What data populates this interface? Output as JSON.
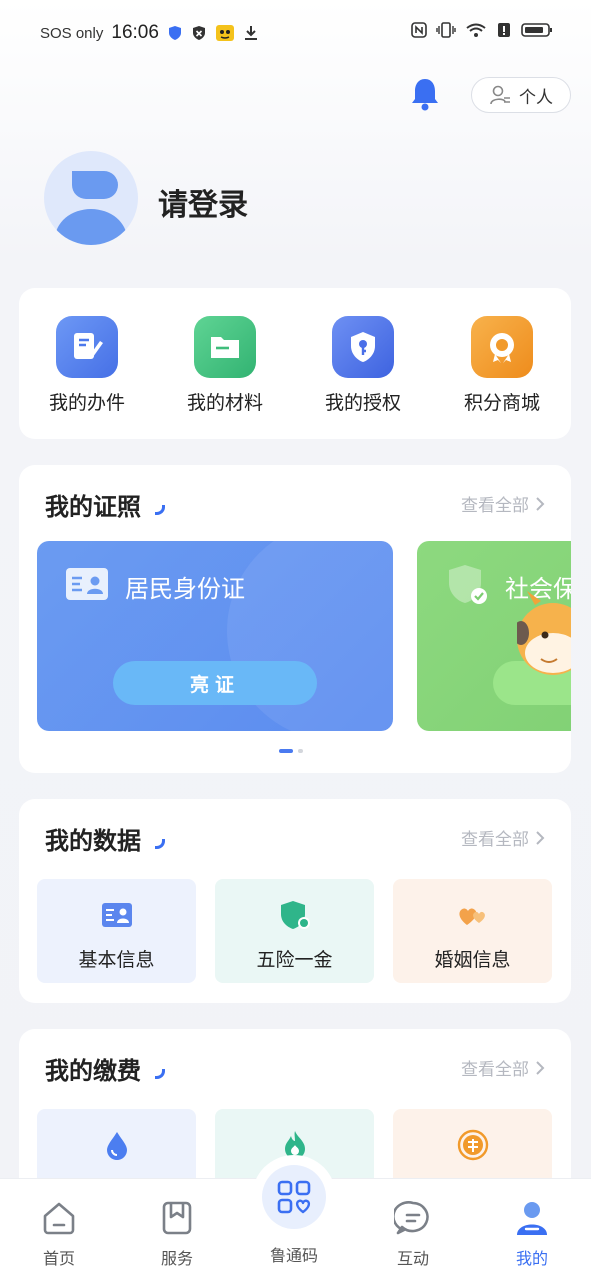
{
  "status_bar": {
    "carrier": "SOS only",
    "time": "16:06"
  },
  "header": {
    "personal_label": "个人"
  },
  "profile": {
    "login_text": "请登录"
  },
  "quick_entries": [
    {
      "label": "我的办件",
      "icon": "edit-doc-icon",
      "color": "#4c79ec"
    },
    {
      "label": "我的材料",
      "icon": "folder-icon",
      "color": "#3fbd7b"
    },
    {
      "label": "我的授权",
      "icon": "shield-key-icon",
      "color": "#4a6fe8"
    },
    {
      "label": "积分商城",
      "icon": "badge-award-icon",
      "color": "#f19a2b"
    }
  ],
  "licenses": {
    "title": "我的证照",
    "see_all": "查看全部",
    "cards": [
      {
        "name": "居民身份证",
        "button": "亮证",
        "icon": "id-card-icon"
      },
      {
        "name": "社会保",
        "icon": "social-security-icon"
      }
    ]
  },
  "my_data": {
    "title": "我的数据",
    "see_all": "查看全部",
    "items": [
      {
        "label": "基本信息",
        "icon": "id-card-icon",
        "bg": "#edf2fd"
      },
      {
        "label": "五险一金",
        "icon": "insurance-shield-icon",
        "bg": "#eaf7f5"
      },
      {
        "label": "婚姻信息",
        "icon": "hearts-icon",
        "bg": "#fdf2ea"
      }
    ]
  },
  "my_fees": {
    "title": "我的缴费",
    "see_all": "查看全部",
    "items": [
      {
        "icon": "water-drop-icon",
        "bg": "#edf2fd"
      },
      {
        "icon": "flame-icon",
        "bg": "#eaf7f5"
      },
      {
        "icon": "tax-coin-icon",
        "bg": "#fdf2ea"
      }
    ]
  },
  "bottom_nav": [
    {
      "label": "首页",
      "icon": "home-icon"
    },
    {
      "label": "服务",
      "icon": "bookmark-icon"
    },
    {
      "label": "鲁通码",
      "icon": "qr-grid-icon"
    },
    {
      "label": "互动",
      "icon": "chat-bubble-icon"
    },
    {
      "label": "我的",
      "icon": "user-icon",
      "active": true
    }
  ]
}
